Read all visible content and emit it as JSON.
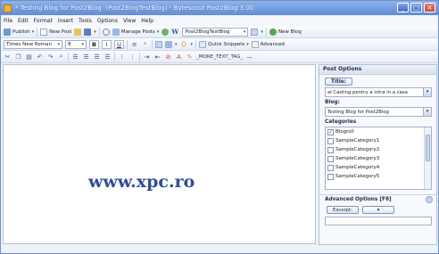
{
  "window": {
    "title": "* Testing Blog for Post2Blog :(Post2BlogTestBlog) - Bytescout Post2Blog 3.00"
  },
  "menu": [
    "File",
    "Edit",
    "Format",
    "Insert",
    "Tools",
    "Options",
    "View",
    "Help"
  ],
  "toolbar1": {
    "publish": "Publish",
    "new_post": "New Post",
    "manage_posts": "Manage Posts",
    "blog_select": "Post2BlogTestBlog",
    "new_blog": "New Blog"
  },
  "toolbar2": {
    "font": "Times New Roman",
    "size": "8",
    "bold": "B",
    "italic": "I",
    "underline": "U",
    "quick_snippets": "Quick Snippets",
    "advanced": "Advanced"
  },
  "toolbar3": {
    "more_tag": "_MORE_TEXT_TAG_"
  },
  "editor": {
    "watermark": "www.xpc.ro"
  },
  "sidebar": {
    "header": "Post Options",
    "title_label": "Title:",
    "title_value": "al Casting pentru a intra in a casa",
    "blog_label": "Blog:",
    "blog_value": "Testing Blog for Post2Blog",
    "categories_label": "Categories",
    "categories": [
      {
        "name": "Blogroll",
        "checked": true
      },
      {
        "name": "SampleCategory1",
        "checked": false
      },
      {
        "name": "SampleCategory2",
        "checked": false
      },
      {
        "name": "SampleCategory3",
        "checked": false
      },
      {
        "name": "SampleCategory4",
        "checked": false
      },
      {
        "name": "SampleCategory5",
        "checked": false
      }
    ],
    "advanced_label": "Advanced Options [F8]",
    "excerpt_button": "Excerpt:"
  },
  "colors": {
    "titlebar": "#5f8bd8",
    "watermark": "#2f4d9a",
    "window_bg": "#eef3fa"
  }
}
